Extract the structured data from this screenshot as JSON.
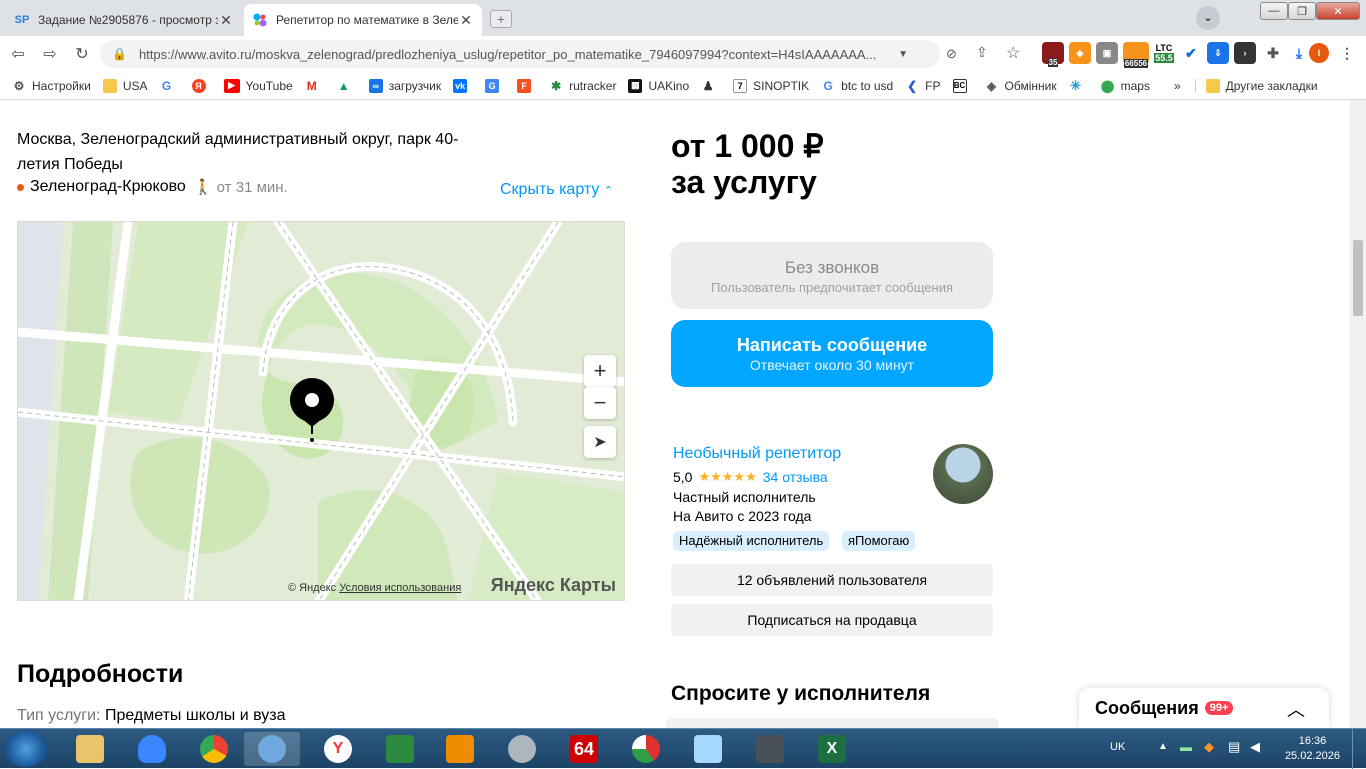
{
  "browser": {
    "tabs": [
      {
        "label": "Задание №2905876 - просмотр з",
        "favicon": "SP"
      },
      {
        "label": "Репетитор по математике в Зеле",
        "favicon": ""
      }
    ],
    "url": "https://www.avito.ru/moskva_zelenograd/predlozheniya_uslug/repetitor_po_matematike_7946097994?context=H4sIAAAAAAA...",
    "extensions": {
      "badge_35": "35",
      "badge_66556": "66556",
      "ltc_label": "LTC",
      "ltc_value": "55.5"
    },
    "bookmarks": [
      "Настройки",
      "USA",
      "",
      "",
      "YouTube",
      "",
      "",
      "загрузчик",
      "",
      "",
      "",
      "rutracker",
      "UAKino",
      "",
      "SINOPTIK",
      "btc to usd",
      "FP",
      "",
      "Обмінник",
      "",
      "maps"
    ],
    "other_bookmarks": "Другие закладки"
  },
  "listing": {
    "address": "Москва, Зеленоградский административный округ, парк 40-летия Победы",
    "metro": "Зеленоград-Крюково",
    "walk": "от 31 мин.",
    "hide_map": "Скрыть карту",
    "map": {
      "zoom_in": "+",
      "zoom_out": "−",
      "copyright": "© Яндекс",
      "terms": "Условия использования",
      "brand": "Яндекс Карты"
    },
    "details_title": "Подробности",
    "service_label": "Тип услуги:",
    "service_value": "Предметы школы и вуза"
  },
  "sidebar": {
    "price_line1": "от 1 000 ₽",
    "price_line2": "за услугу",
    "no_calls": "Без звонков",
    "no_calls_sub": "Пользователь предпочитает сообщения",
    "message_btn": "Написать сообщение",
    "message_sub": "Отвечает около 30 минут",
    "seller_name": "Необычный репетитор",
    "rating": "5,0",
    "stars": "★★★★★",
    "reviews": "34 отзыва",
    "seller_type": "Частный исполнитель",
    "since": "На Авито с 2023 года",
    "badges": [
      "Надёжный исполнитель",
      "яПомогаю"
    ],
    "listings_btn": "12 объявлений пользователя",
    "subscribe_btn": "Подписаться на продавца",
    "ask_title": "Спросите у исполнителя"
  },
  "messages": {
    "title": "Сообщения",
    "count": "99+"
  },
  "taskbar": {
    "lang": "UK",
    "time": "16:36",
    "date": "25.02.2026",
    "app_64": "64"
  }
}
